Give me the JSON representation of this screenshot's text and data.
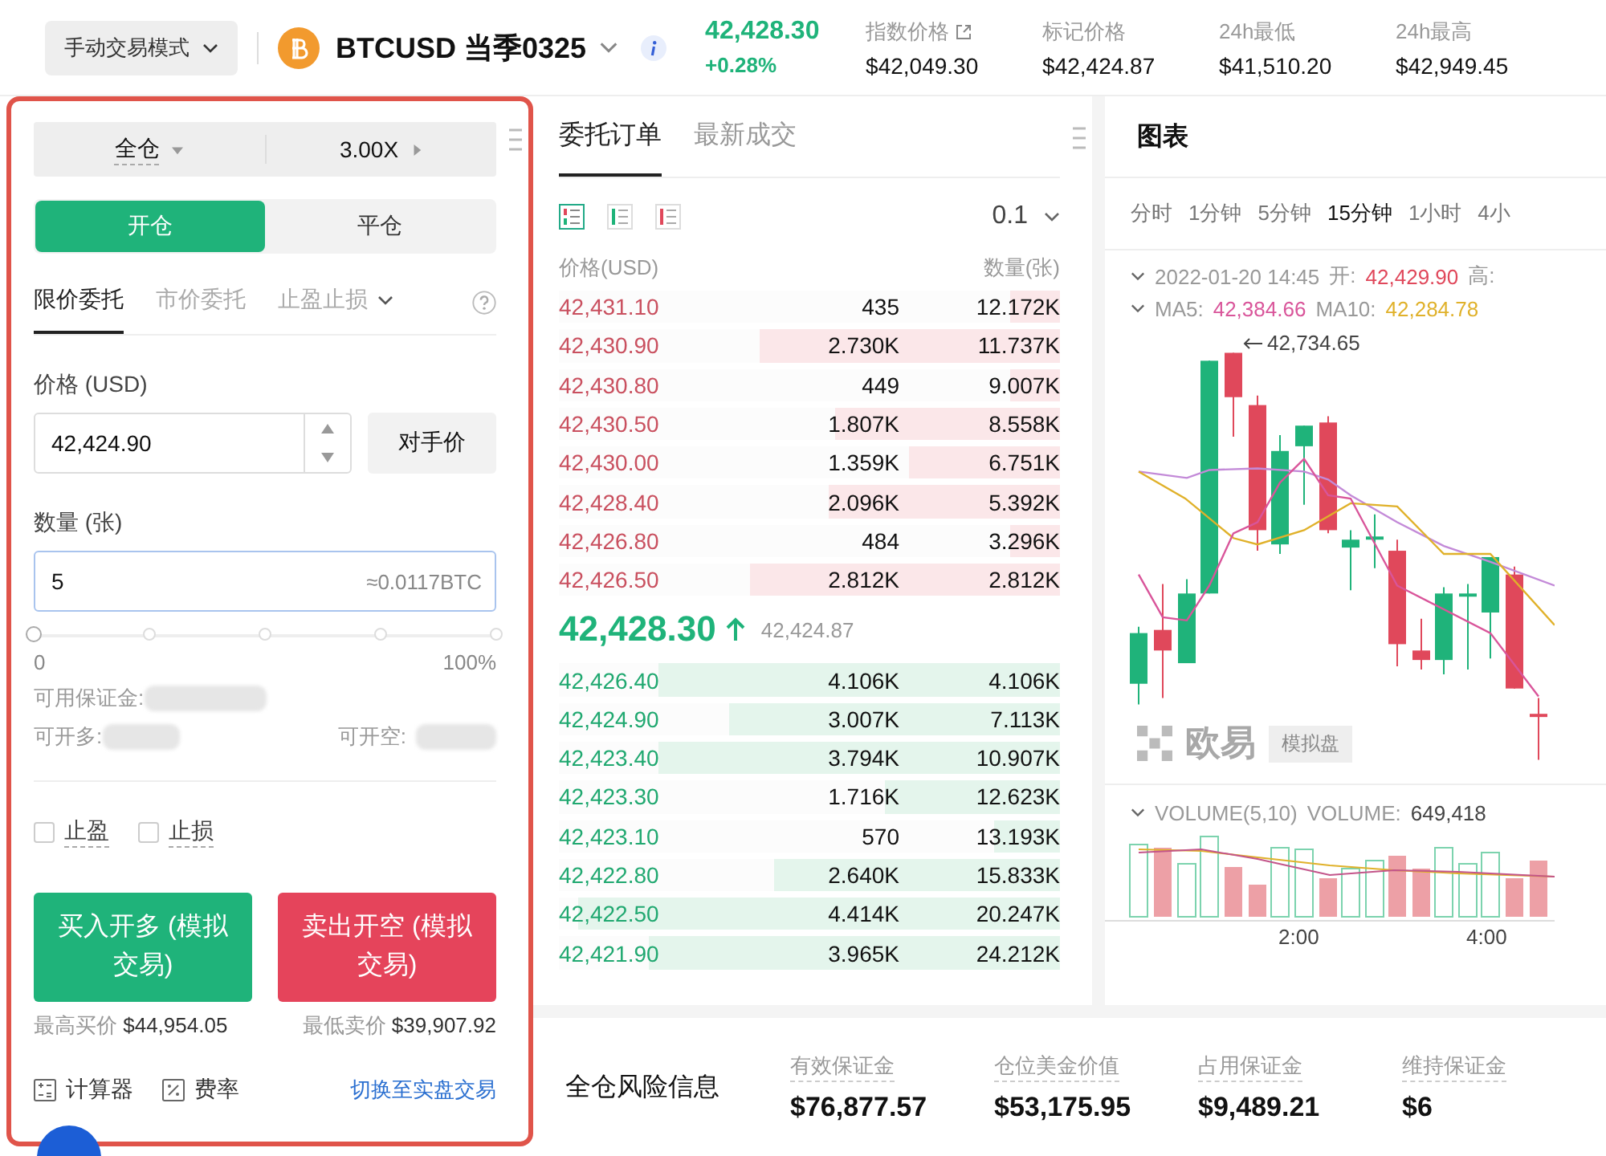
{
  "header": {
    "mode_button": "手动交易模式",
    "symbol": "BTCUSD 当季0325",
    "last_price": "42,428.30",
    "change": "+0.28%",
    "stats": [
      {
        "label": "指数价格",
        "value": "$42,049.30",
        "link": true
      },
      {
        "label": "标记价格",
        "value": "$42,424.87",
        "link": false
      },
      {
        "label": "24h最低",
        "value": "$41,510.20",
        "link": false
      },
      {
        "label": "24h最高",
        "value": "$42,949.45",
        "link": false
      }
    ]
  },
  "order_form": {
    "margin_mode": "全仓",
    "leverage": "3.00X",
    "sides": [
      {
        "label": "开仓",
        "selected": true
      },
      {
        "label": "平仓",
        "selected": false
      }
    ],
    "order_types": [
      {
        "label": "限价委托",
        "selected": true,
        "dropdown": false
      },
      {
        "label": "市价委托",
        "selected": false,
        "dropdown": false
      },
      {
        "label": "止盈止损",
        "selected": false,
        "dropdown": true
      }
    ],
    "price_label": "价格 (USD)",
    "price_value": "42,424.90",
    "counter_price_button": "对手价",
    "amount_label": "数量 (张)",
    "amount_value": "5",
    "amount_hint": "≈0.0117BTC",
    "slider": {
      "level": 0,
      "min_label": "0",
      "max_label": "100%"
    },
    "available_margin_label": "可用保证金:",
    "can_long_label": "可开多:",
    "can_short_label": "可开空:",
    "checkboxes": [
      {
        "label": "止盈",
        "checked": false
      },
      {
        "label": "止损",
        "checked": false
      }
    ],
    "buy_button": "买入开多 (模拟交易)",
    "sell_button": "卖出开空 (模拟交易)",
    "max_buy": {
      "label": "最高买价",
      "value": "$44,954.05"
    },
    "min_sell": {
      "label": "最低卖价",
      "value": "$39,907.92"
    },
    "tools": [
      {
        "kind": "calculator",
        "label": "计算器"
      },
      {
        "kind": "rate",
        "label": "费率"
      }
    ],
    "switch_link": "切换至实盘交易"
  },
  "order_book": {
    "tabs": [
      {
        "label": "委托订单",
        "selected": true
      },
      {
        "label": "最新成交",
        "selected": false
      }
    ],
    "depth": "0.1",
    "columns": [
      "价格(USD)",
      "数量(张)"
    ],
    "asks": [
      {
        "price": "42,431.10",
        "size": "435",
        "total": "12.172K",
        "level": 0.1
      },
      {
        "price": "42,430.90",
        "size": "2.730K",
        "total": "11.737K",
        "level": 0.6
      },
      {
        "price": "42,430.80",
        "size": "449",
        "total": "9.007K",
        "level": 0.1
      },
      {
        "price": "42,430.50",
        "size": "1.807K",
        "total": "8.558K",
        "level": 0.45
      },
      {
        "price": "42,430.00",
        "size": "1.359K",
        "total": "6.751K",
        "level": 0.3
      },
      {
        "price": "42,428.40",
        "size": "2.096K",
        "total": "5.392K",
        "level": 0.46
      },
      {
        "price": "42,426.80",
        "size": "484",
        "total": "3.296K",
        "level": 0.1
      },
      {
        "price": "42,426.50",
        "size": "2.812K",
        "total": "2.812K",
        "level": 0.62
      }
    ],
    "last_price": "42,428.30",
    "mark_price": "42,424.87",
    "bids": [
      {
        "price": "42,426.40",
        "size": "4.106K",
        "total": "4.106K",
        "level": 0.8
      },
      {
        "price": "42,424.90",
        "size": "3.007K",
        "total": "7.113K",
        "level": 0.66
      },
      {
        "price": "42,423.40",
        "size": "3.794K",
        "total": "10.907K",
        "level": 0.8
      },
      {
        "price": "42,423.30",
        "size": "1.716K",
        "total": "12.623K",
        "level": 0.35
      },
      {
        "price": "42,423.10",
        "size": "570",
        "total": "13.193K",
        "level": 0.13
      },
      {
        "price": "42,422.80",
        "size": "2.640K",
        "total": "15.833K",
        "level": 0.57
      },
      {
        "price": "42,422.50",
        "size": "4.414K",
        "total": "20.247K",
        "level": 0.96
      },
      {
        "price": "42,421.90",
        "size": "3.965K",
        "total": "24.212K",
        "level": 0.82
      }
    ]
  },
  "chart": {
    "title": "图表",
    "intervals": [
      {
        "label": "分时",
        "selected": false
      },
      {
        "label": "1分钟",
        "selected": false
      },
      {
        "label": "5分钟",
        "selected": false
      },
      {
        "label": "15分钟",
        "selected": true
      },
      {
        "label": "1小时",
        "selected": false
      },
      {
        "label": "4小",
        "selected": false
      }
    ],
    "date": "2022-01-20 14:45",
    "open_label": "开:",
    "open_value": "42,429.90",
    "high_label": "高:",
    "ma": [
      {
        "label": "MA5:",
        "value": "42,384.66",
        "color": "#d9559a"
      },
      {
        "label": "MA10:",
        "value": "42,284.78",
        "color": "#e0b12a"
      }
    ],
    "high_marker": "42,734.65",
    "brand": "欧易",
    "brand_badge": "模拟盘",
    "volume_label": "VOLUME(5,10)",
    "volume_value_label": "VOLUME:",
    "volume_value": "649,418",
    "x_ticks": [
      "2:00",
      "4:00"
    ]
  },
  "risk": {
    "title": "全仓风险信息",
    "items": [
      {
        "label": "有效保证金",
        "value": "$76,877.57"
      },
      {
        "label": "仓位美金价值",
        "value": "$53,175.95"
      },
      {
        "label": "占用保证金",
        "value": "$9,489.21"
      },
      {
        "label": "维持保证金",
        "value": "$6"
      }
    ]
  }
}
